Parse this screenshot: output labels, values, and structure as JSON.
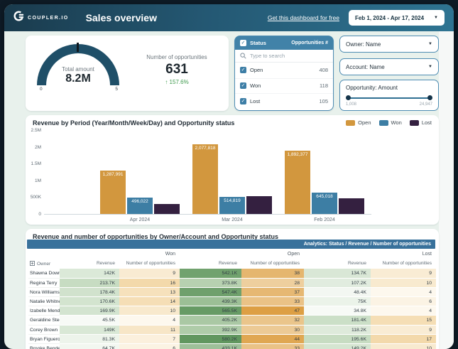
{
  "header": {
    "brand": "COUPLER.IO",
    "title": "Sales overview",
    "cta": "Get this dashboard for free",
    "date_range": "Feb 1, 2024 - Apr 17, 2024"
  },
  "kpis": {
    "gauge": {
      "label": "Total amount",
      "value": "8.2M",
      "scale_min": "0",
      "scale_max": "5"
    },
    "opps": {
      "label": "Number of opportunities",
      "value": "631",
      "delta": "157.6%"
    }
  },
  "status_panel": {
    "title": "Status",
    "col": "Opportunities #",
    "search_placeholder": "Type to search",
    "rows": [
      {
        "label": "Open",
        "value": "408",
        "checked": true
      },
      {
        "label": "Won",
        "value": "118",
        "checked": true
      },
      {
        "label": "Lost",
        "value": "105",
        "checked": true
      }
    ]
  },
  "filters": {
    "owner_label": "Owner: Name",
    "account_label": "Account: Name",
    "amount_label": "Opportunity: Amount",
    "amount_min": "1,008",
    "amount_max": "24,947"
  },
  "chart_data": {
    "type": "bar",
    "title": "Revenue by Period (Year/Month/Week/Day) and Opportunity status",
    "categories": [
      "Apr 2024",
      "Mar 2024",
      "Feb 2024"
    ],
    "series": [
      {
        "name": "Open",
        "color": "#d2973e",
        "values": [
          1287991,
          2077818,
          1892377
        ],
        "labels": [
          "1,287,991",
          "2,077,818",
          "1,892,377"
        ]
      },
      {
        "name": "Won",
        "color": "#3d7ea4",
        "values": [
          496022,
          514819,
          645018
        ],
        "labels": [
          "496,022",
          "514,819",
          "645,018"
        ]
      },
      {
        "name": "Lost",
        "color": "#342040",
        "values": [
          295000,
          525000,
          465000
        ],
        "labels": [
          "",
          "",
          ""
        ]
      }
    ],
    "ylim": [
      0,
      2500000
    ],
    "yticks": [
      {
        "label": "2.5M",
        "value": 2500000
      },
      {
        "label": "2M",
        "value": 2000000
      },
      {
        "label": "1.5M",
        "value": 1500000
      },
      {
        "label": "1M",
        "value": 1000000
      },
      {
        "label": "500K",
        "value": 500000
      },
      {
        "label": "0",
        "value": 0
      }
    ],
    "legend_position": "top-right",
    "grid": false
  },
  "table": {
    "title": "Revenue and number of opportunities by Owner/Account and Opportunity status",
    "analytics_label": "Analytics: Status / Revenue / Number of opportunities",
    "groups": [
      "Won",
      "Open",
      "Lost"
    ],
    "owner_header": "Owner",
    "sub_headers": [
      "Revenue",
      "Number of opportunities"
    ],
    "rows": [
      [
        "Shawna Downs",
        "142K",
        "9",
        "542.1K",
        "38",
        "134.7K",
        "9"
      ],
      [
        "Regina Terry",
        "213.7K",
        "16",
        "373.8K",
        "28",
        "107.2K",
        "10"
      ],
      [
        "Nora Williamso..",
        "178.4K",
        "13",
        "547.4K",
        "37",
        "48.4K",
        "4"
      ],
      [
        "Natalie Whitney",
        "170.6K",
        "14",
        "439.3K",
        "33",
        "75K",
        "6"
      ],
      [
        "Izabelle Mend..",
        "169.9K",
        "10",
        "565.5K",
        "47",
        "34.8K",
        "4"
      ],
      [
        "Geraldine Steel",
        "45.5K",
        "4",
        "405.2K",
        "32",
        "181.4K",
        "15"
      ],
      [
        "Corey Brown",
        "149K",
        "11",
        "392.9K",
        "30",
        "118.2K",
        "9"
      ],
      [
        "Bryan Figueroa",
        "81.3K",
        "7",
        "580.2K",
        "44",
        "195.6K",
        "17"
      ],
      [
        "Brooke Bender",
        "64.7K",
        "6",
        "433.1K",
        "33",
        "149.2K",
        "10"
      ]
    ],
    "heat": [
      null,
      {
        "from": "#f7faf6",
        "to": "#c7dcc2"
      },
      {
        "from": "#fdf8ee",
        "to": "#f3d9ab"
      },
      {
        "from": "#b7d1b0",
        "to": "#61975f"
      },
      {
        "from": "#eecf9e",
        "to": "#dd9f44"
      },
      {
        "from": "#f7faf6",
        "to": "#c7dcc2"
      },
      {
        "from": "#fdf8ee",
        "to": "#f3d9ab"
      }
    ]
  }
}
